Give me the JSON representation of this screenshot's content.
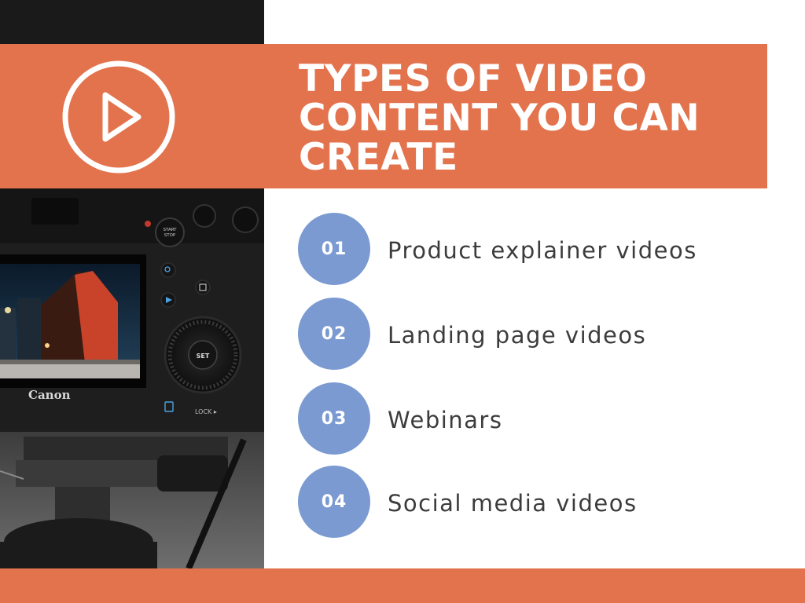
{
  "title": "TYPES OF VIDEO CONTENT YOU CAN CREATE",
  "badge_icon": "play-icon",
  "photo": {
    "camera_brand": "Canon",
    "buttons": {
      "start_stop": "START STOP",
      "set": "SET",
      "lock": "LOCK"
    }
  },
  "items": [
    {
      "number": "01",
      "label": "Product explainer videos"
    },
    {
      "number": "02",
      "label": "Landing page videos"
    },
    {
      "number": "03",
      "label": "Webinars"
    },
    {
      "number": "04",
      "label": "Social media videos"
    }
  ],
  "colors": {
    "accent_orange": "#e3734d",
    "number_circle_blue": "#7b9ad1",
    "text_dark": "#3c3c3c",
    "background": "#ffffff"
  }
}
